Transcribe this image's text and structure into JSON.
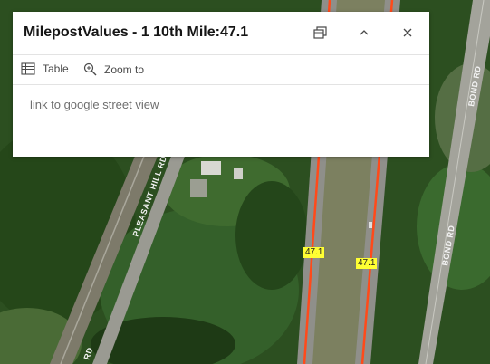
{
  "popup": {
    "title": "MilepostValues - 1 10th Mile:47.1",
    "actions": [
      {
        "label": "Table",
        "icon": "table-icon"
      },
      {
        "label": "Zoom to",
        "icon": "zoom-to-icon"
      }
    ],
    "link_text": "link to google street view",
    "header_buttons": [
      "dock-icon",
      "collapse-chevron-up-icon",
      "close-icon"
    ]
  },
  "map": {
    "road_labels": [
      "BOND RD",
      "BOND RD",
      "PLEASANT HILL RD",
      "RD"
    ],
    "milepost_labels": [
      "47.1",
      "47.1"
    ],
    "colors": {
      "highway_line": "#ff4a1a",
      "milepost_label_bg": "#ffff33",
      "forest_dark": "#1f3b14",
      "forest": "#2f5a22",
      "road_surface": "#8f8f8a"
    }
  }
}
